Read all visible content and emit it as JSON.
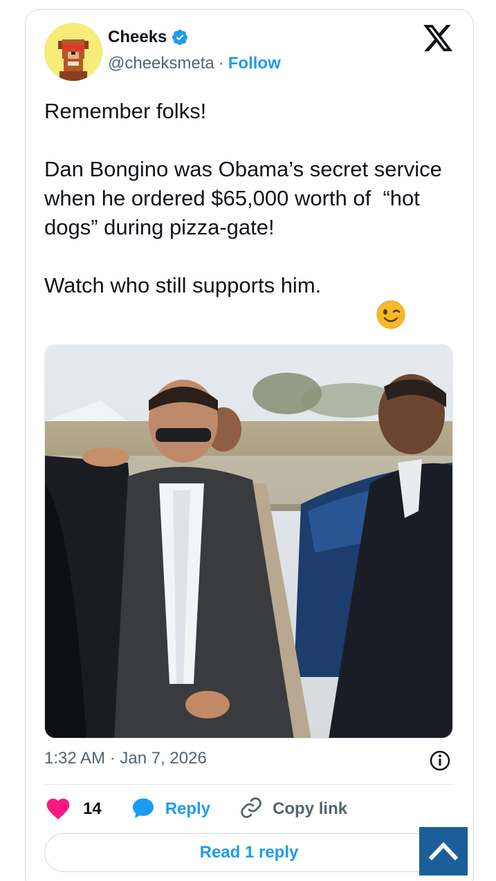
{
  "author": {
    "name": "Cheeks",
    "handle": "@cheeksmeta",
    "separator": "·",
    "follow_label": "Follow",
    "verified_color": "#1d9bf0",
    "avatar_icon": "pixel-dog-avatar-icon"
  },
  "brand": {
    "logo_icon": "x-logo-icon"
  },
  "tweet": {
    "text": "Remember folks!\n\nDan Bongino was Obama’s secret service when he ordered $65,000 worth of  “hot dogs” during pizza-gate!\n\nWatch who still supports him.",
    "emoji": "winking-face-icon",
    "media_icon": "photo-of-men-near-car"
  },
  "meta": {
    "timestamp": "1:32 AM · Jan 7, 2026",
    "info_icon": "info-icon"
  },
  "actions": {
    "like_count": "14",
    "reply_label": "Reply",
    "copy_link_label": "Copy link",
    "like_color": "#f91880",
    "reply_color": "#1d9bf0"
  },
  "read_reply_label": "Read 1 reply",
  "scroll_top_icon": "chevron-up-icon",
  "colors": {
    "accent": "#1d9bf0",
    "muted": "#536471",
    "text": "#0f1419"
  }
}
